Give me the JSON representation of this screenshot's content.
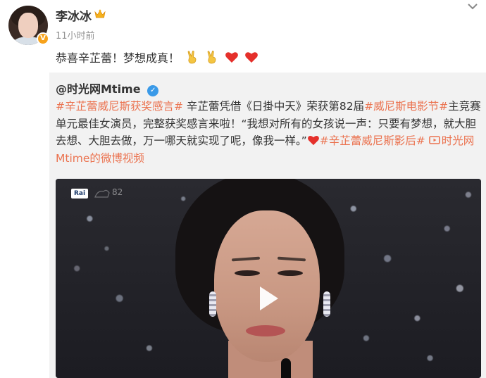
{
  "header": {
    "username": "李冰冰",
    "timestamp": "11小时前",
    "post_text": "恭喜辛芷蕾！梦想成真！"
  },
  "repost": {
    "author": "@时光网Mtime",
    "body": {
      "topic1": "#辛芷蕾威尼斯获奖感言#",
      "text1": " 辛芷蕾凭借《日掛中天》荣获第82届",
      "topic2": "#威尼斯电影节#",
      "text2": "主竞赛单元最佳女演员，完整获奖感言来啦！“我想对所有的女孩说一声：只要有梦想，就大胆去想、大胆去做，万一哪天就实现了呢，像我一样。”",
      "topic3": "#辛芷蕾威尼斯影后#",
      "video_link": "时光网Mtime的微博视频"
    }
  },
  "video": {
    "watermark_channel": "Rai",
    "watermark_edition": "82"
  },
  "icons": {
    "crown": "crown-icon",
    "verified_orange": "verified-badge-icon",
    "verified_blue": "verified-blue-icon",
    "more": "chevron-down-icon",
    "victory_hand": "victory-hand-emoji",
    "heart": "red-heart-emoji",
    "play": "play-icon",
    "video_link": "video-link-icon"
  },
  "colors": {
    "topic": "#eb7350",
    "repost_bg": "#f2f2f2",
    "verified_orange": "#f7a21b",
    "verified_blue": "#3a9ae8",
    "timestamp": "#939393"
  }
}
